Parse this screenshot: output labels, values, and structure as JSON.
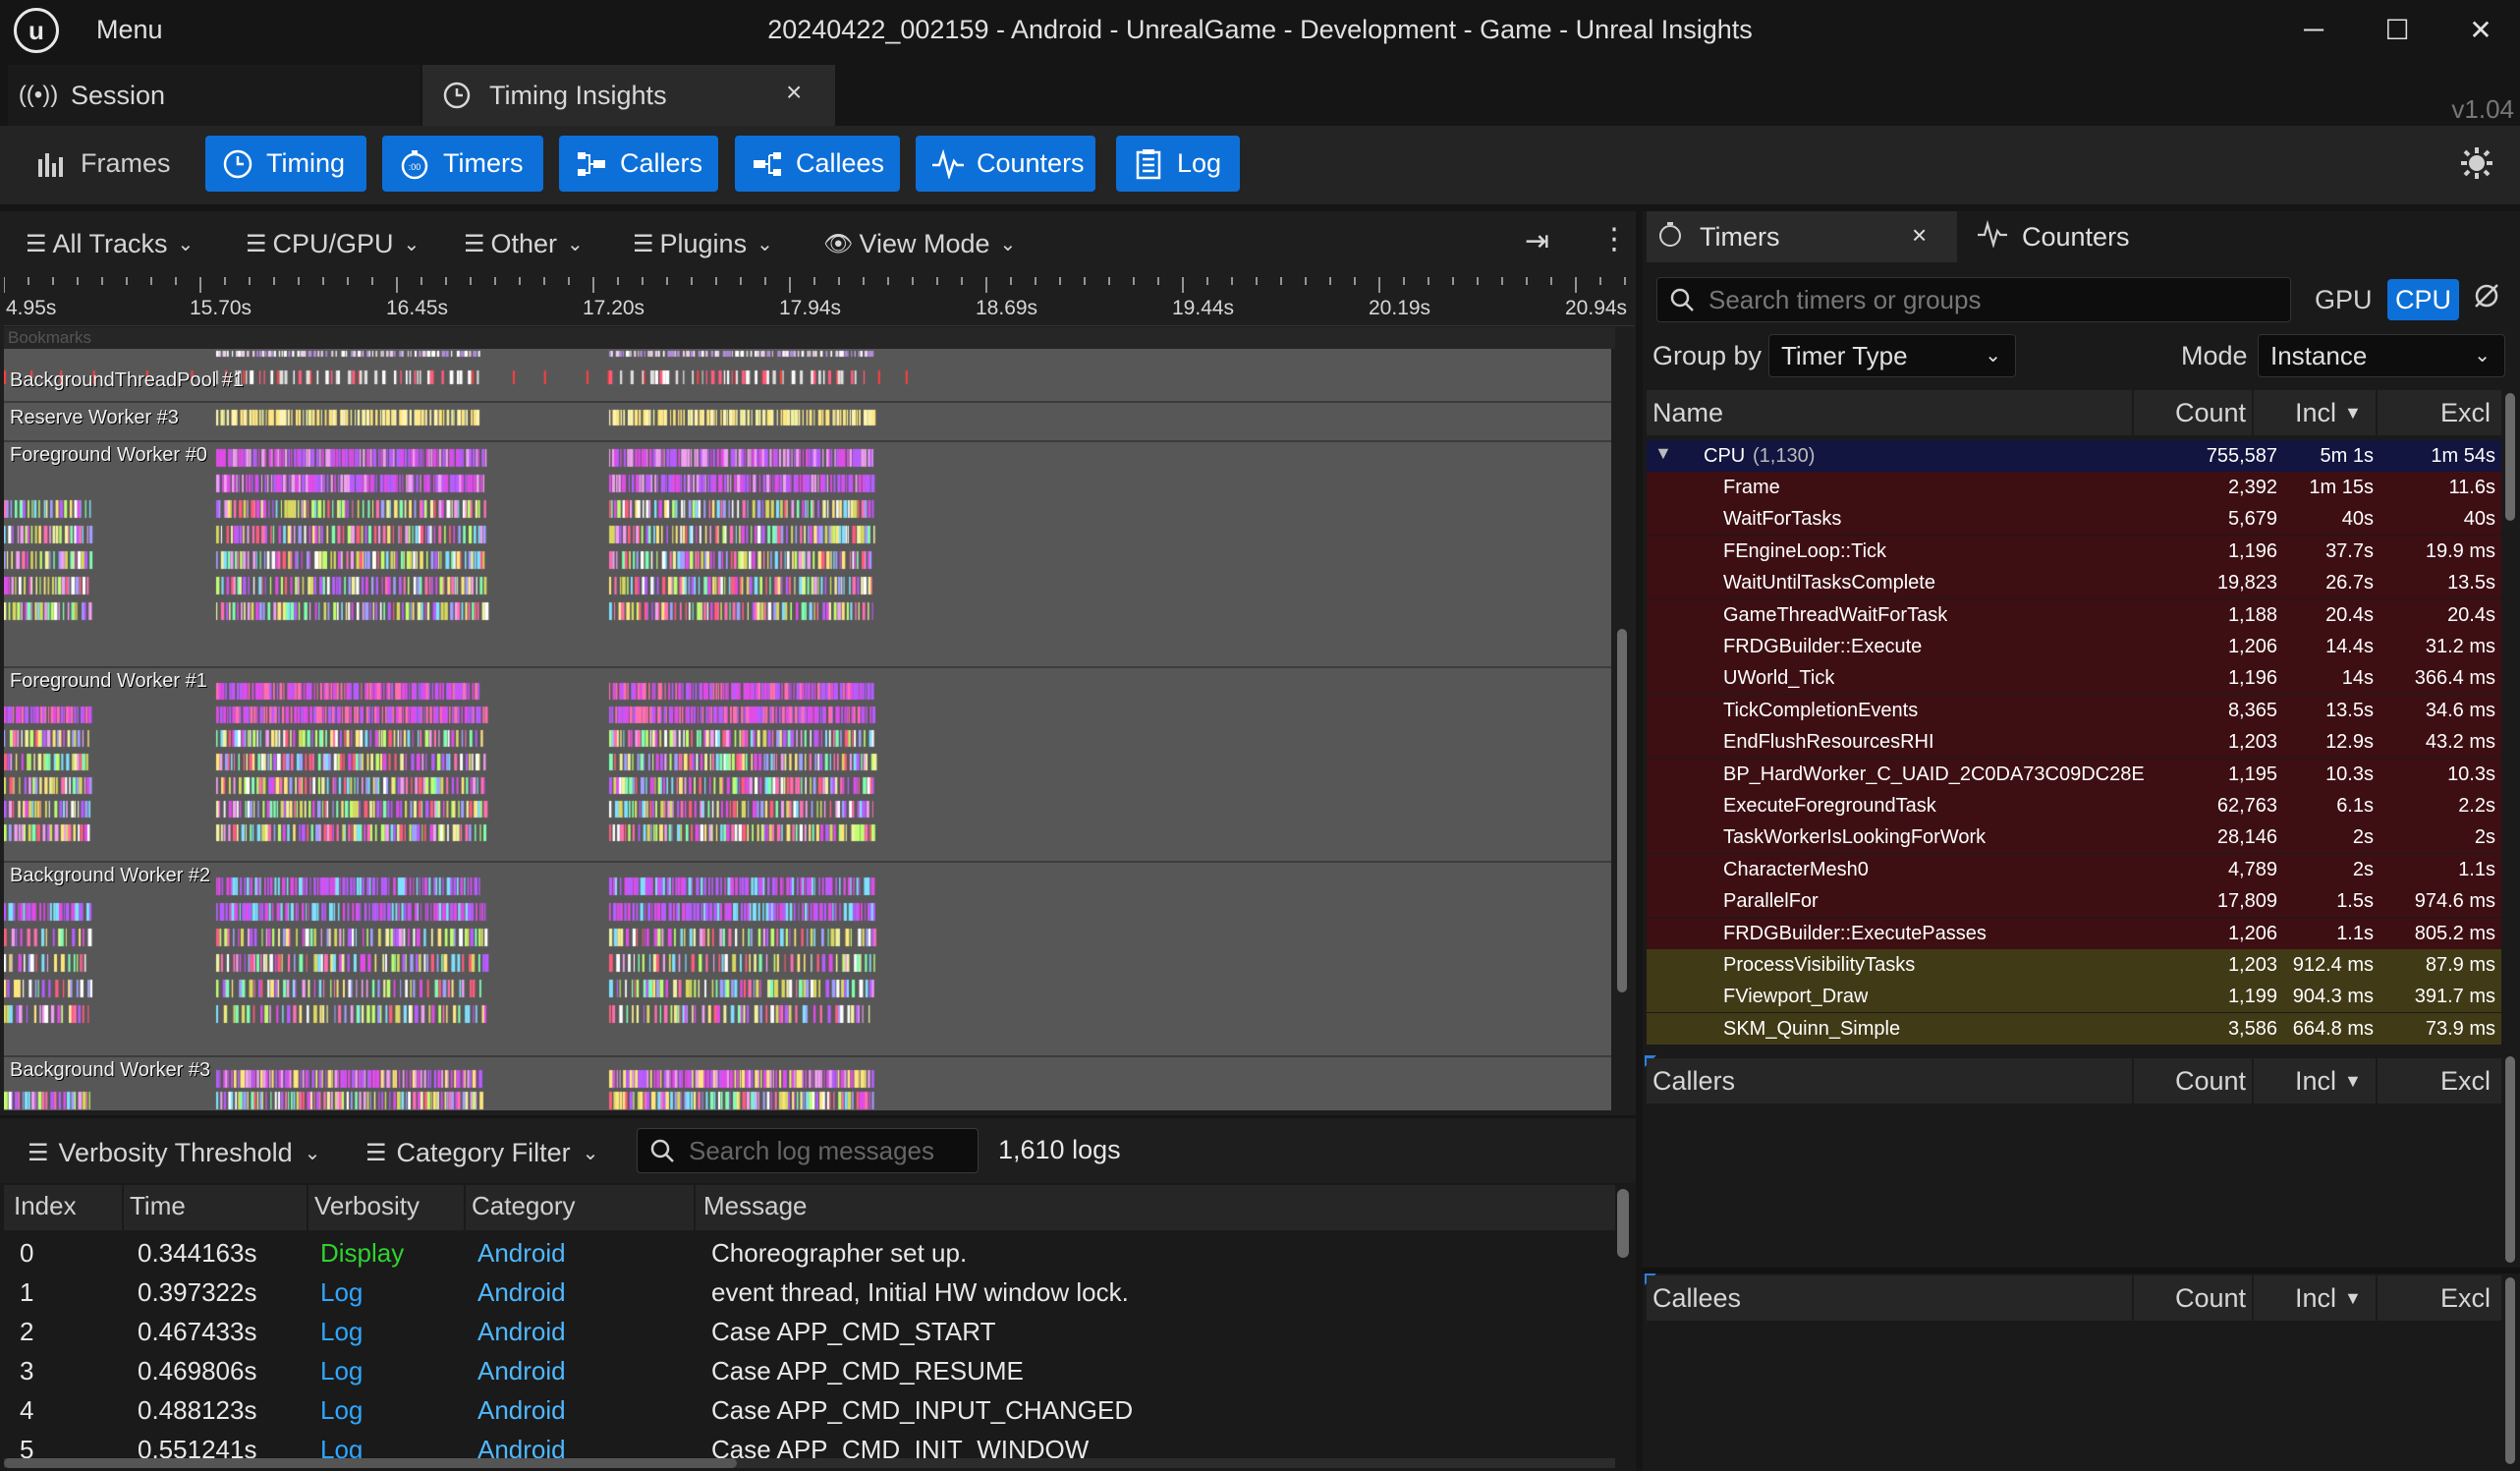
{
  "window": {
    "menu_label": "Menu",
    "title": "20240422_002159 - Android - UnrealGame - Development - Game - Unreal Insights",
    "minimize": "─",
    "maximize": "☐",
    "close": "✕"
  },
  "tabs": {
    "session_label": "Session",
    "timing_label": "Timing Insights",
    "close": "×",
    "version": "v1.04"
  },
  "toolbar": {
    "frames": "Frames",
    "timing": "Timing",
    "timers": "Timers",
    "callers": "Callers",
    "callees": "Callees",
    "counters": "Counters",
    "log": "Log"
  },
  "timing_view": {
    "all_tracks": "All Tracks",
    "cpu_gpu": "CPU/GPU",
    "other": "Other",
    "plugins": "Plugins",
    "view_mode": "View Mode",
    "ticks": [
      "4.95s",
      "15.70s",
      "16.45s",
      "17.20s",
      "17.94s",
      "18.69s",
      "19.44s",
      "20.19s",
      "20.94s"
    ],
    "bookmarks": "Bookmarks",
    "tracks": [
      "BackgroundThreadPool #1",
      "Reserve Worker #3",
      "Foreground Worker #0",
      "Foreground Worker #1",
      "Background Worker #2",
      "Background Worker #3"
    ]
  },
  "log": {
    "verbosity_threshold": "Verbosity Threshold",
    "category_filter": "Category Filter",
    "search_placeholder": "Search log messages",
    "count": "1,610 logs",
    "columns": {
      "index": "Index",
      "time": "Time",
      "verbosity": "Verbosity",
      "category": "Category",
      "message": "Message"
    },
    "rows": [
      {
        "index": "0",
        "time": "0.344163s",
        "verbosity": "Display",
        "category": "Android",
        "message": "Choreographer set up."
      },
      {
        "index": "1",
        "time": "0.397322s",
        "verbosity": "Log",
        "category": "Android",
        "message": "event thread, Initial HW window lock."
      },
      {
        "index": "2",
        "time": "0.467433s",
        "verbosity": "Log",
        "category": "Android",
        "message": "Case APP_CMD_START"
      },
      {
        "index": "3",
        "time": "0.469806s",
        "verbosity": "Log",
        "category": "Android",
        "message": "Case APP_CMD_RESUME"
      },
      {
        "index": "4",
        "time": "0.488123s",
        "verbosity": "Log",
        "category": "Android",
        "message": "Case APP_CMD_INPUT_CHANGED"
      },
      {
        "index": "5",
        "time": "0.551241s",
        "verbosity": "Log",
        "category": "Android",
        "message": "Case APP_CMD_INIT_WINDOW"
      }
    ],
    "colors": {
      "display": "#2fd32f",
      "log": "#2fa6ff",
      "category": "#4fb8ff"
    }
  },
  "timers_panel": {
    "tab_label": "Timers",
    "counters_tab": "Counters",
    "close": "×",
    "search_placeholder": "Search timers or groups",
    "gpu": "GPU",
    "cpu": "CPU",
    "group_by_label": "Group by",
    "group_by_value": "Timer Type",
    "mode_label": "Mode",
    "mode_value": "Instance",
    "columns": {
      "name": "Name",
      "count": "Count",
      "incl": "Incl",
      "excl": "Excl"
    },
    "group": {
      "name": "CPU",
      "sub": "(1,130)",
      "count": "755,587",
      "incl": "5m 1s",
      "excl": "1m 54s"
    },
    "rows": [
      {
        "name": "Frame",
        "count": "2,392",
        "incl": "1m 15s",
        "excl": "11.6s",
        "tone": "red"
      },
      {
        "name": "WaitForTasks",
        "count": "5,679",
        "incl": "40s",
        "excl": "40s",
        "tone": "red"
      },
      {
        "name": "FEngineLoop::Tick",
        "count": "1,196",
        "incl": "37.7s",
        "excl": "19.9 ms",
        "tone": "red"
      },
      {
        "name": "WaitUntilTasksComplete",
        "count": "19,823",
        "incl": "26.7s",
        "excl": "13.5s",
        "tone": "red"
      },
      {
        "name": "GameThreadWaitForTask",
        "count": "1,188",
        "incl": "20.4s",
        "excl": "20.4s",
        "tone": "red"
      },
      {
        "name": "FRDGBuilder::Execute",
        "count": "1,206",
        "incl": "14.4s",
        "excl": "31.2 ms",
        "tone": "red"
      },
      {
        "name": "UWorld_Tick",
        "count": "1,196",
        "incl": "14s",
        "excl": "366.4 ms",
        "tone": "red"
      },
      {
        "name": "TickCompletionEvents",
        "count": "8,365",
        "incl": "13.5s",
        "excl": "34.6 ms",
        "tone": "red"
      },
      {
        "name": "EndFlushResourcesRHI",
        "count": "1,203",
        "incl": "12.9s",
        "excl": "43.2 ms",
        "tone": "red"
      },
      {
        "name": "BP_HardWorker_C_UAID_2C0DA73C09DC28E",
        "count": "1,195",
        "incl": "10.3s",
        "excl": "10.3s",
        "tone": "red"
      },
      {
        "name": "ExecuteForegroundTask",
        "count": "62,763",
        "incl": "6.1s",
        "excl": "2.2s",
        "tone": "red"
      },
      {
        "name": "TaskWorkerIsLookingForWork",
        "count": "28,146",
        "incl": "2s",
        "excl": "2s",
        "tone": "red"
      },
      {
        "name": "CharacterMesh0",
        "count": "4,789",
        "incl": "2s",
        "excl": "1.1s",
        "tone": "red"
      },
      {
        "name": "ParallelFor",
        "count": "17,809",
        "incl": "1.5s",
        "excl": "974.6 ms",
        "tone": "red"
      },
      {
        "name": "FRDGBuilder::ExecutePasses",
        "count": "1,206",
        "incl": "1.1s",
        "excl": "805.2 ms",
        "tone": "red"
      },
      {
        "name": "ProcessVisibilityTasks",
        "count": "1,203",
        "incl": "912.4 ms",
        "excl": "87.9 ms",
        "tone": "olive"
      },
      {
        "name": "FViewport_Draw",
        "count": "1,199",
        "incl": "904.3 ms",
        "excl": "391.7 ms",
        "tone": "olive"
      },
      {
        "name": "SKM_Quinn_Simple",
        "count": "3,586",
        "incl": "664.8 ms",
        "excl": "73.9 ms",
        "tone": "olive"
      }
    ],
    "colors": {
      "group": "#111540",
      "red": "#3d0f13",
      "olive": "#413a16"
    }
  },
  "callers_panel": {
    "title": "Callers",
    "count": "Count",
    "incl": "Incl",
    "excl": "Excl"
  },
  "callees_panel": {
    "title": "Callees",
    "count": "Count",
    "incl": "Incl",
    "excl": "Excl"
  }
}
